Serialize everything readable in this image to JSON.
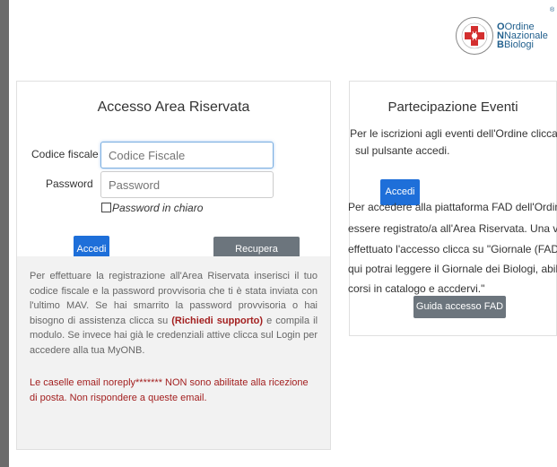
{
  "logo": {
    "line1": "Ordine",
    "line2": "Nazionale",
    "line3": "Biologi",
    "registered": "®",
    "accent_color": "#d32f2f",
    "brand_color": "#1f5e8c"
  },
  "login": {
    "title": "Accesso Area Riservata",
    "codice_label": "Codice fiscale",
    "codice_placeholder": "Codice Fiscale",
    "password_label": "Password",
    "password_placeholder": "Password",
    "show_password_label": "Password in chiaro",
    "submit_label": "Accedi",
    "recover_label": "Recupera password",
    "info_part1": "Per effettuare la registrazione all'Area Riservata inserisci il tuo codice fiscale e la password provvisoria che ti è stata inviata con l'ultimo MAV. Se hai smarrito la password provvisoria o hai bisogno di assistenza clicca su ",
    "info_link": "(Richiedi supporto)",
    "info_part2": " e compila il modulo. Se invece hai già le credenziali attive clicca sul Login per accedere alla tua MyONB.",
    "warning": "Le caselle email noreply******* NON sono abilitate alla ricezione di posta. Non rispondere a queste email."
  },
  "events": {
    "title": "Partecipazione Eventi",
    "intro_line1": "Per le iscrizioni agli eventi dell'Ordine clicca",
    "intro_line2": "sul pulsante accedi.",
    "accedi_label": "Accedi",
    "fad_line1": "Per accedere alla piattaforma FAD dell'Ordine de",
    "fad_line2": "essere registrato/a all'Area Riservata. Una volta",
    "fad_line3": "effettuato l'accesso clicca su \"Giornale (FAD). Da",
    "fad_line4": "qui potrai leggere il Giornale dei Biologi, abilitarti",
    "fad_line5": "corsi in catalogo e accdervi.\"",
    "guide_label": "Guida accesso FAD"
  }
}
